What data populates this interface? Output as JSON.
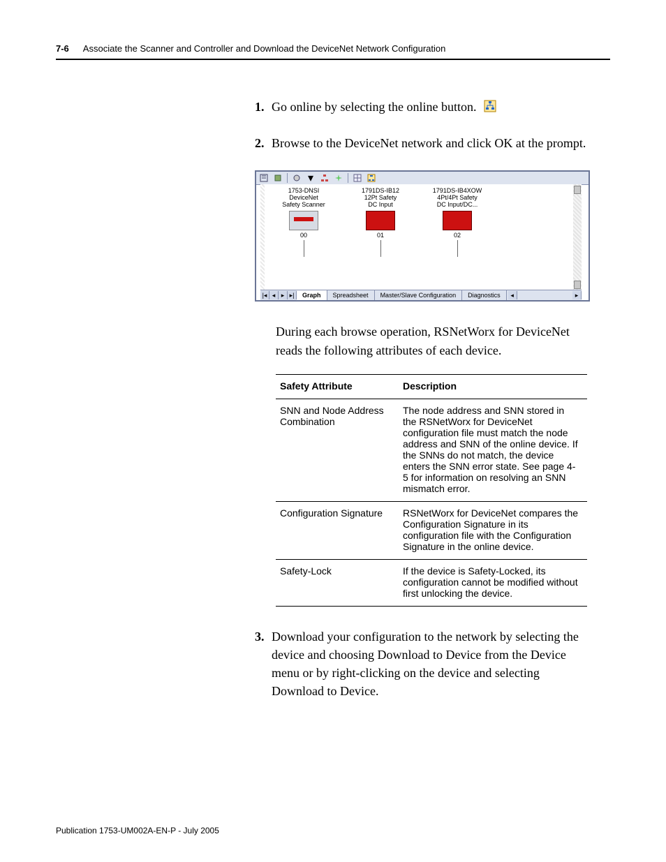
{
  "header": {
    "page_number": "7-6",
    "title": "Associate the Scanner and Controller and Download the DeviceNet Network Configuration"
  },
  "steps": {
    "s1_num": "1.",
    "s1_text": "Go online by selecting the online button.",
    "s2_num": "2.",
    "s2_text": "Browse to the DeviceNet network and click OK at the prompt.",
    "s3_num": "3.",
    "s3_text": "Download your configuration to the network by selecting the device and choosing Download to Device from the Device menu or by right-clicking on the device and selecting Download to Device."
  },
  "screenshot": {
    "devices": [
      {
        "line1": "1753-DNSI",
        "line2": "DeviceNet",
        "line3": "Safety Scanner",
        "addr": "00"
      },
      {
        "line1": "1791DS-IB12",
        "line2": "12Pt Safety",
        "line3": "DC Input",
        "addr": "01"
      },
      {
        "line1": "1791DS-IB4XOW",
        "line2": "4Pt/4Pt Safety",
        "line3": "DC Input/DC...",
        "addr": "02"
      }
    ],
    "tabs": {
      "graph": "Graph",
      "spreadsheet": "Spreadsheet",
      "master_slave": "Master/Slave Configuration",
      "diagnostics": "Diagnostics"
    }
  },
  "post_screenshot_para": "During each browse operation, RSNetWorx for DeviceNet reads the following attributes of each device.",
  "table": {
    "col1_header": "Safety Attribute",
    "col2_header": "Description",
    "rows": [
      {
        "attr": "SNN and Node Address Combination",
        "desc": "The node address and SNN stored in the RSNetWorx for DeviceNet configuration file must match the node address and SNN of the online device. If the SNNs do not match, the device enters the SNN error state. See page 4-5 for information on resolving an SNN mismatch error."
      },
      {
        "attr": "Configuration Signature",
        "desc": "RSNetWorx for DeviceNet compares the Configuration Signature in its configuration file with the Configuration Signature in the online device."
      },
      {
        "attr": "Safety-Lock",
        "desc": "If the device is Safety-Locked, its configuration cannot be modified without first unlocking the device."
      }
    ]
  },
  "footer": "Publication 1753-UM002A-EN-P - July 2005"
}
